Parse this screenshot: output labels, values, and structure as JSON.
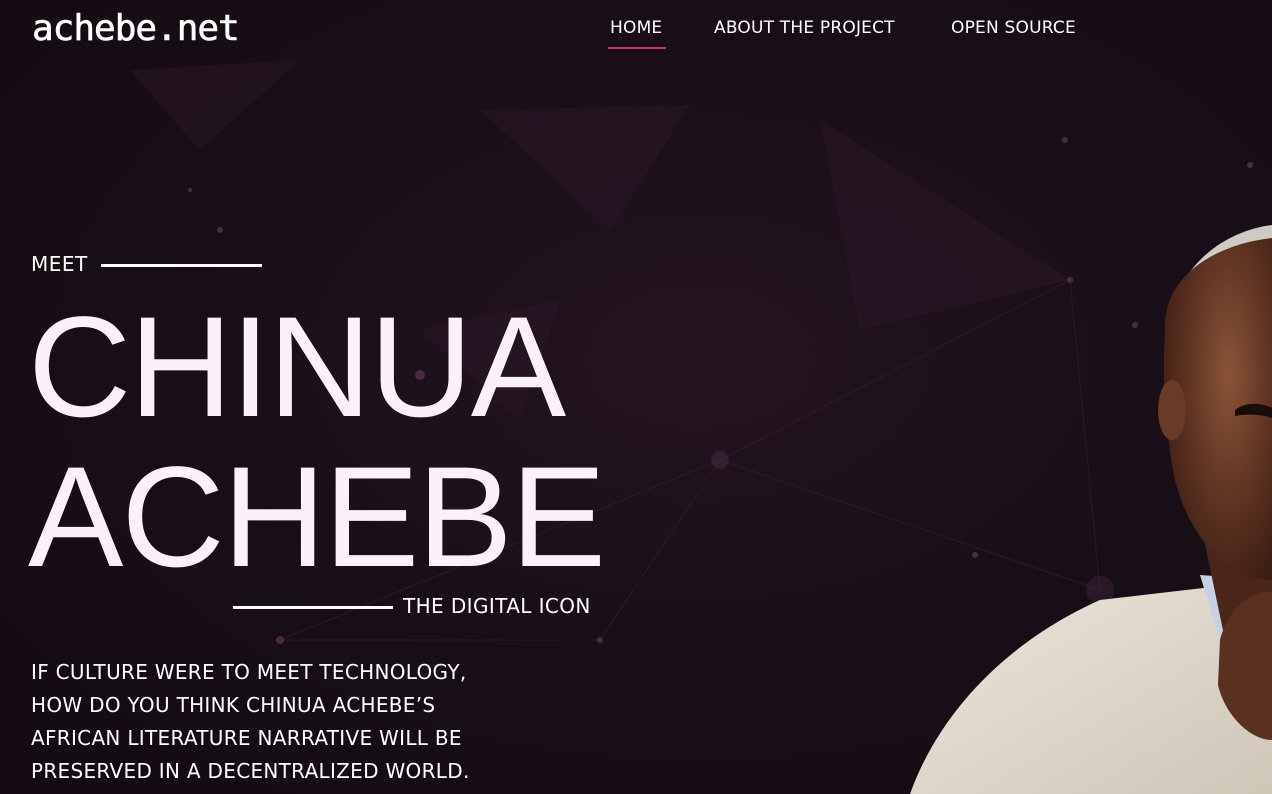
{
  "header": {
    "logo": "achebe.net",
    "nav": [
      {
        "label": "HOME",
        "active": true
      },
      {
        "label": "ABOUT THE PROJECT",
        "active": false
      },
      {
        "label": "OPEN SOURCE",
        "active": false
      }
    ]
  },
  "hero": {
    "kicker": "MEET",
    "name_line1": "CHINUA",
    "name_line2": "ACHEBE",
    "tagline": "THE DIGITAL ICON",
    "lead_lines": [
      "IF CULTURE WERE TO MEET TECHNOLOGY,",
      "HOW DO YOU THINK CHINUA ACHEBE’S",
      "AFRICAN LITERATURE NARRATIVE WILL BE",
      "PRESERVED IN A DECENTRALIZED WORLD."
    ]
  },
  "colors": {
    "background": "#150c13",
    "accent": "#c0395a",
    "text": "#ffffff"
  }
}
